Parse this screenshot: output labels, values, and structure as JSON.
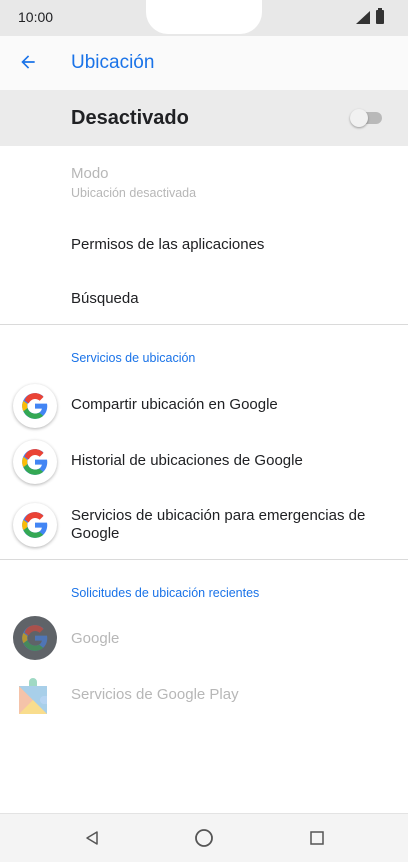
{
  "status_bar": {
    "time": "10:00"
  },
  "app_bar": {
    "title": "Ubicación"
  },
  "master_switch": {
    "label": "Desactivado",
    "on": false
  },
  "items": {
    "mode": {
      "title": "Modo",
      "subtitle": "Ubicación desactivada"
    },
    "app_permissions": "Permisos de las aplicaciones",
    "scanning": "Búsqueda"
  },
  "location_services": {
    "header": "Servicios de ubicación",
    "items": [
      {
        "label": "Compartir ubicación en Google",
        "icon": "google-g-icon"
      },
      {
        "label": "Historial de ubicaciones de Google",
        "icon": "google-g-icon"
      },
      {
        "label": "Servicios de ubicación para emergencias de Google",
        "icon": "google-g-icon"
      }
    ]
  },
  "recent_requests": {
    "header": "Solicitudes de ubicación recientes",
    "items": [
      {
        "label": "Google",
        "icon": "google-g-icon"
      },
      {
        "label": "Servicios de Google Play",
        "icon": "puzzle-icon"
      }
    ]
  },
  "colors": {
    "accent": "#1a73e8",
    "disabled_text": "#b7b7b7",
    "master_bg": "#ebebeb"
  }
}
